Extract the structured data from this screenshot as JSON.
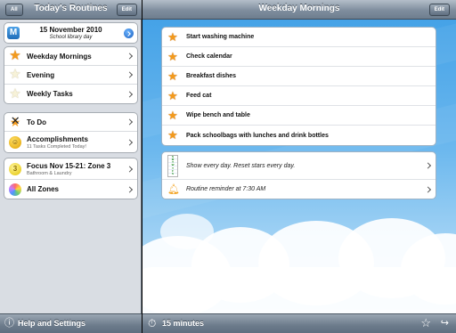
{
  "left": {
    "nav": {
      "all_label": "All",
      "title": "Today's Routines",
      "edit_label": "Edit"
    },
    "date": {
      "main": "15 November 2010",
      "sub": "School library day",
      "icon": "M"
    },
    "routines": [
      {
        "label": "Weekday Mornings",
        "icon": "star-icon"
      },
      {
        "label": "Evening",
        "icon": "star-outline-icon"
      },
      {
        "label": "Weekly Tasks",
        "icon": "star-outline-icon"
      }
    ],
    "todo": {
      "label": "To Do"
    },
    "accomplishments": {
      "label": "Accomplishments",
      "sub": "11 Tasks Completed Today!"
    },
    "focus": {
      "label": "Focus Nov 15-21: Zone 3",
      "sub": "Bathroom & Laundry",
      "icon_text": "3"
    },
    "zones": {
      "label": "All Zones"
    },
    "toolbar": {
      "label": "Help and Settings"
    }
  },
  "right": {
    "nav": {
      "title": "Weekday Mornings",
      "edit_label": "Edit"
    },
    "tasks": [
      "Start washing machine",
      "Check calendar",
      "Breakfast dishes",
      "Feed cat",
      "Wipe bench and table",
      "Pack schoolbags with lunches and drink bottles"
    ],
    "schedule": {
      "text": "Show every day. Reset stars every day.",
      "cal_letters": [
        "S",
        "M",
        "T",
        "W",
        "T",
        "F",
        "S"
      ]
    },
    "reminder": {
      "text": "Routine reminder at 7:30 AM"
    },
    "toolbar": {
      "timer_label": "15 minutes"
    }
  },
  "colors": {
    "star": "#f39a1c",
    "accent_blue": "#1f6db8",
    "sky": "#6cb8ee"
  }
}
